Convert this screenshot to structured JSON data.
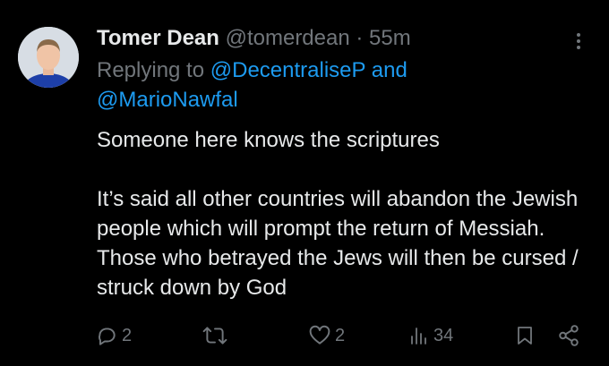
{
  "author": {
    "name": "Tomer Dean",
    "handle": "@tomerdean",
    "separator": "·",
    "time": "55m"
  },
  "reply": {
    "prefix": "Replying to",
    "mention_1": "@DecentraliseP",
    "conjunction": "and",
    "mention_2": "@MarioNawfal"
  },
  "body": {
    "line_1": "Someone here knows the scriptures",
    "line_2": "It’s said all other countries will abandon the Jewish people which will prompt the return of Messiah. Those who betrayed the Jews will then be cursed / struck down by God"
  },
  "actions": {
    "replies": "2",
    "retweets": "",
    "likes": "2",
    "views": "34"
  },
  "colors": {
    "background": "#000000",
    "text": "#e7e9ea",
    "muted": "#71767b",
    "link": "#1d9bf0"
  },
  "icons": [
    "more-icon",
    "reply-icon",
    "retweet-icon",
    "like-icon",
    "views-icon",
    "bookmark-icon",
    "share-icon"
  ]
}
